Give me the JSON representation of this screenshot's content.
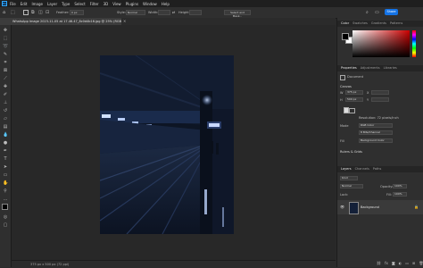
{
  "menu": [
    "File",
    "Edit",
    "Image",
    "Layer",
    "Type",
    "Select",
    "Filter",
    "3D",
    "View",
    "Plugins",
    "Window",
    "Help"
  ],
  "app_logo": "Ps",
  "options": {
    "feather_label": "Feather:",
    "feather_value": "0 px",
    "style_label": "Style:",
    "style_value": "Normal",
    "width_label": "Width:",
    "height_label": "Height:",
    "select_mask": "Select and Mask..."
  },
  "share_label": "Share",
  "document_tab": "WhatsApp Image 2023-11-05 at 17.46.47_8c0d4b16.jpg @ 25% (RGB/8#)",
  "status_bar": "375 px x 500 px (72 ppi)",
  "color_panel": {
    "tabs": [
      "Color",
      "Swatches",
      "Gradients",
      "Patterns"
    ],
    "accent": "#cc0000"
  },
  "properties_panel": {
    "tabs": [
      "Properties",
      "Adjustments",
      "Libraries"
    ],
    "doc_label": "Document",
    "canvas_header": "Canvas",
    "w_value": "375 px",
    "h_value": "500 px",
    "x_label": "X",
    "y_label": "Y",
    "resolution": "Resolution: 72 pixels/inch",
    "mode_label": "Mode",
    "mode_value": "RGB Color",
    "bits_value": "8 Bits/Channel",
    "fill_label": "Fill",
    "fill_value": "Background Color",
    "rulers_grids": "Rulers & Grids"
  },
  "layers_panel": {
    "tabs": [
      "Layers",
      "Channels",
      "Paths"
    ],
    "kind_label": "Kind",
    "mode_value": "Normal",
    "opacity_label": "Opacity:",
    "opacity_value": "100%",
    "lock_label": "Lock:",
    "fill_label": "Fill:",
    "fill_value": "100%",
    "layer_name": "Background"
  },
  "icons": [
    "move-icon",
    "marquee-icon",
    "lasso-icon",
    "quick-select-icon",
    "crop-icon",
    "frame-icon",
    "eyedropper-icon",
    "healing-icon",
    "brush-icon",
    "stamp-icon",
    "history-brush-icon",
    "eraser-icon",
    "gradient-icon",
    "blur-icon",
    "dodge-icon",
    "pen-icon",
    "type-icon",
    "path-select-icon",
    "shape-icon",
    "hand-icon",
    "zoom-icon",
    "more-icon"
  ]
}
